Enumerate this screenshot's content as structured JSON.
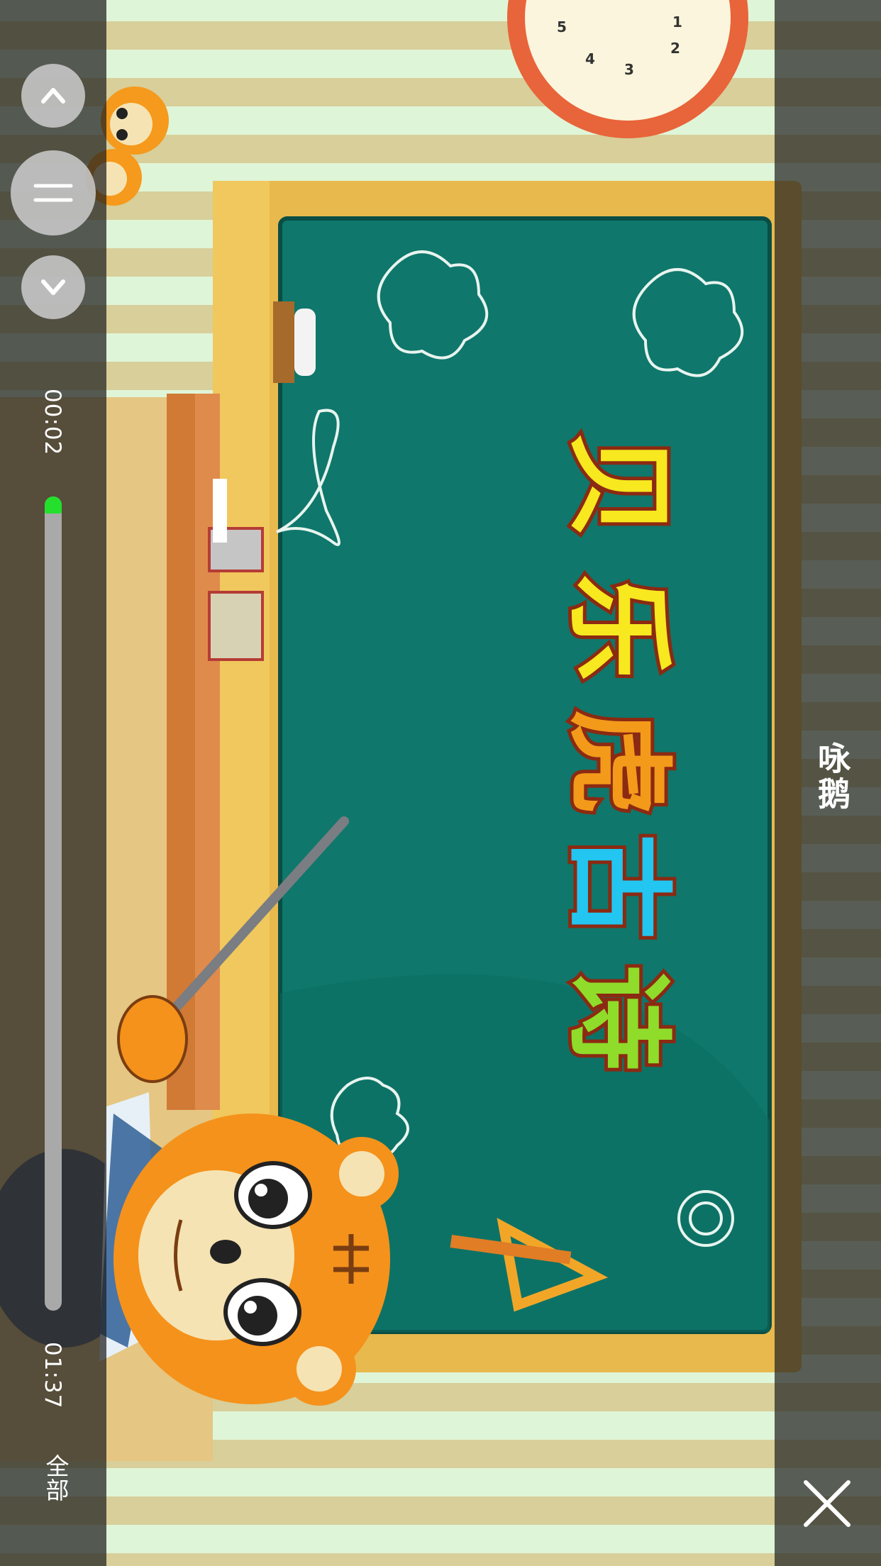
{
  "video": {
    "title": "咏鹅",
    "current_time": "00:02",
    "total_time": "01:37",
    "progress_fraction": 0.02,
    "progress_color": "#24e02d",
    "board_text": [
      "贝",
      "乐",
      "虎",
      "古",
      "诗"
    ],
    "board_text_colors": [
      "#f7e81f",
      "#f7e81f",
      "#f39a1b",
      "#22c6f0",
      "#8fdc2a"
    ]
  },
  "controls": {
    "scroll_up_icon": "chevron-up-icon",
    "menu_icon": "double-line-menu-icon",
    "scroll_down_icon": "chevron-down-icon",
    "all_label": "全部",
    "close_icon": "close-icon"
  }
}
